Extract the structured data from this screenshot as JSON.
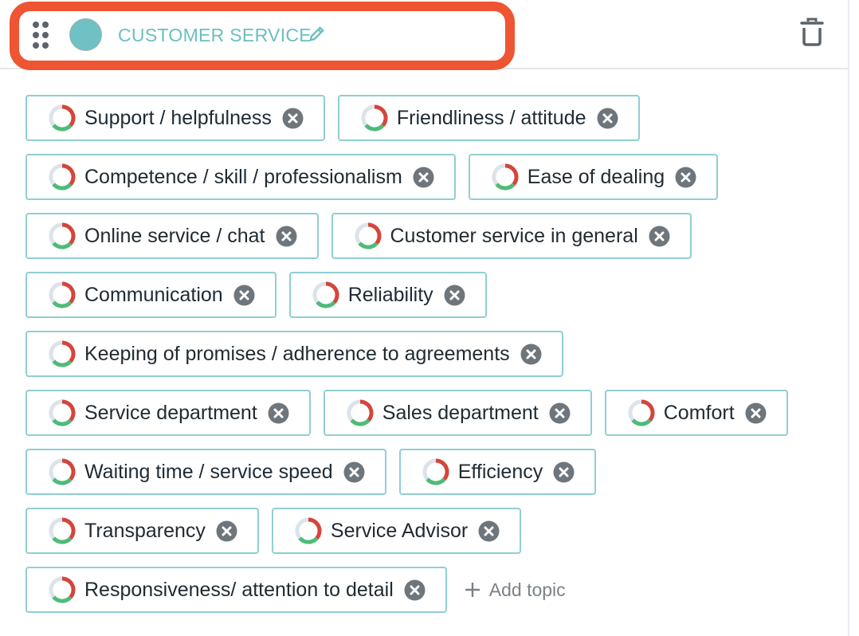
{
  "group": {
    "title": "CUSTOMER SERVICE",
    "color": "#6fc1c3",
    "accent_border_color": "#ee5532"
  },
  "icons": {
    "drag": "drag-handle-icon",
    "edit": "pencil-icon",
    "trash": "trash-icon",
    "sentiment": "sentiment-ring-icon",
    "remove": "remove-circle-icon",
    "add": "plus-icon"
  },
  "rows": [
    [
      "Support / helpfulness",
      "Friendliness / attitude"
    ],
    [
      "Competence / skill / professionalism",
      "Ease of dealing"
    ],
    [
      "Online service / chat",
      "Customer service in general"
    ],
    [
      "Communication",
      "Reliability"
    ],
    [
      "Keeping of promises / adherence to agreements"
    ],
    [
      "Service department",
      "Sales department",
      "Comfort"
    ],
    [
      "Waiting time / service speed",
      "Efficiency"
    ],
    [
      "Transparency",
      "Service Advisor"
    ],
    [
      "Responsiveness/ attention to detail"
    ]
  ],
  "add_topic_label": "Add topic"
}
